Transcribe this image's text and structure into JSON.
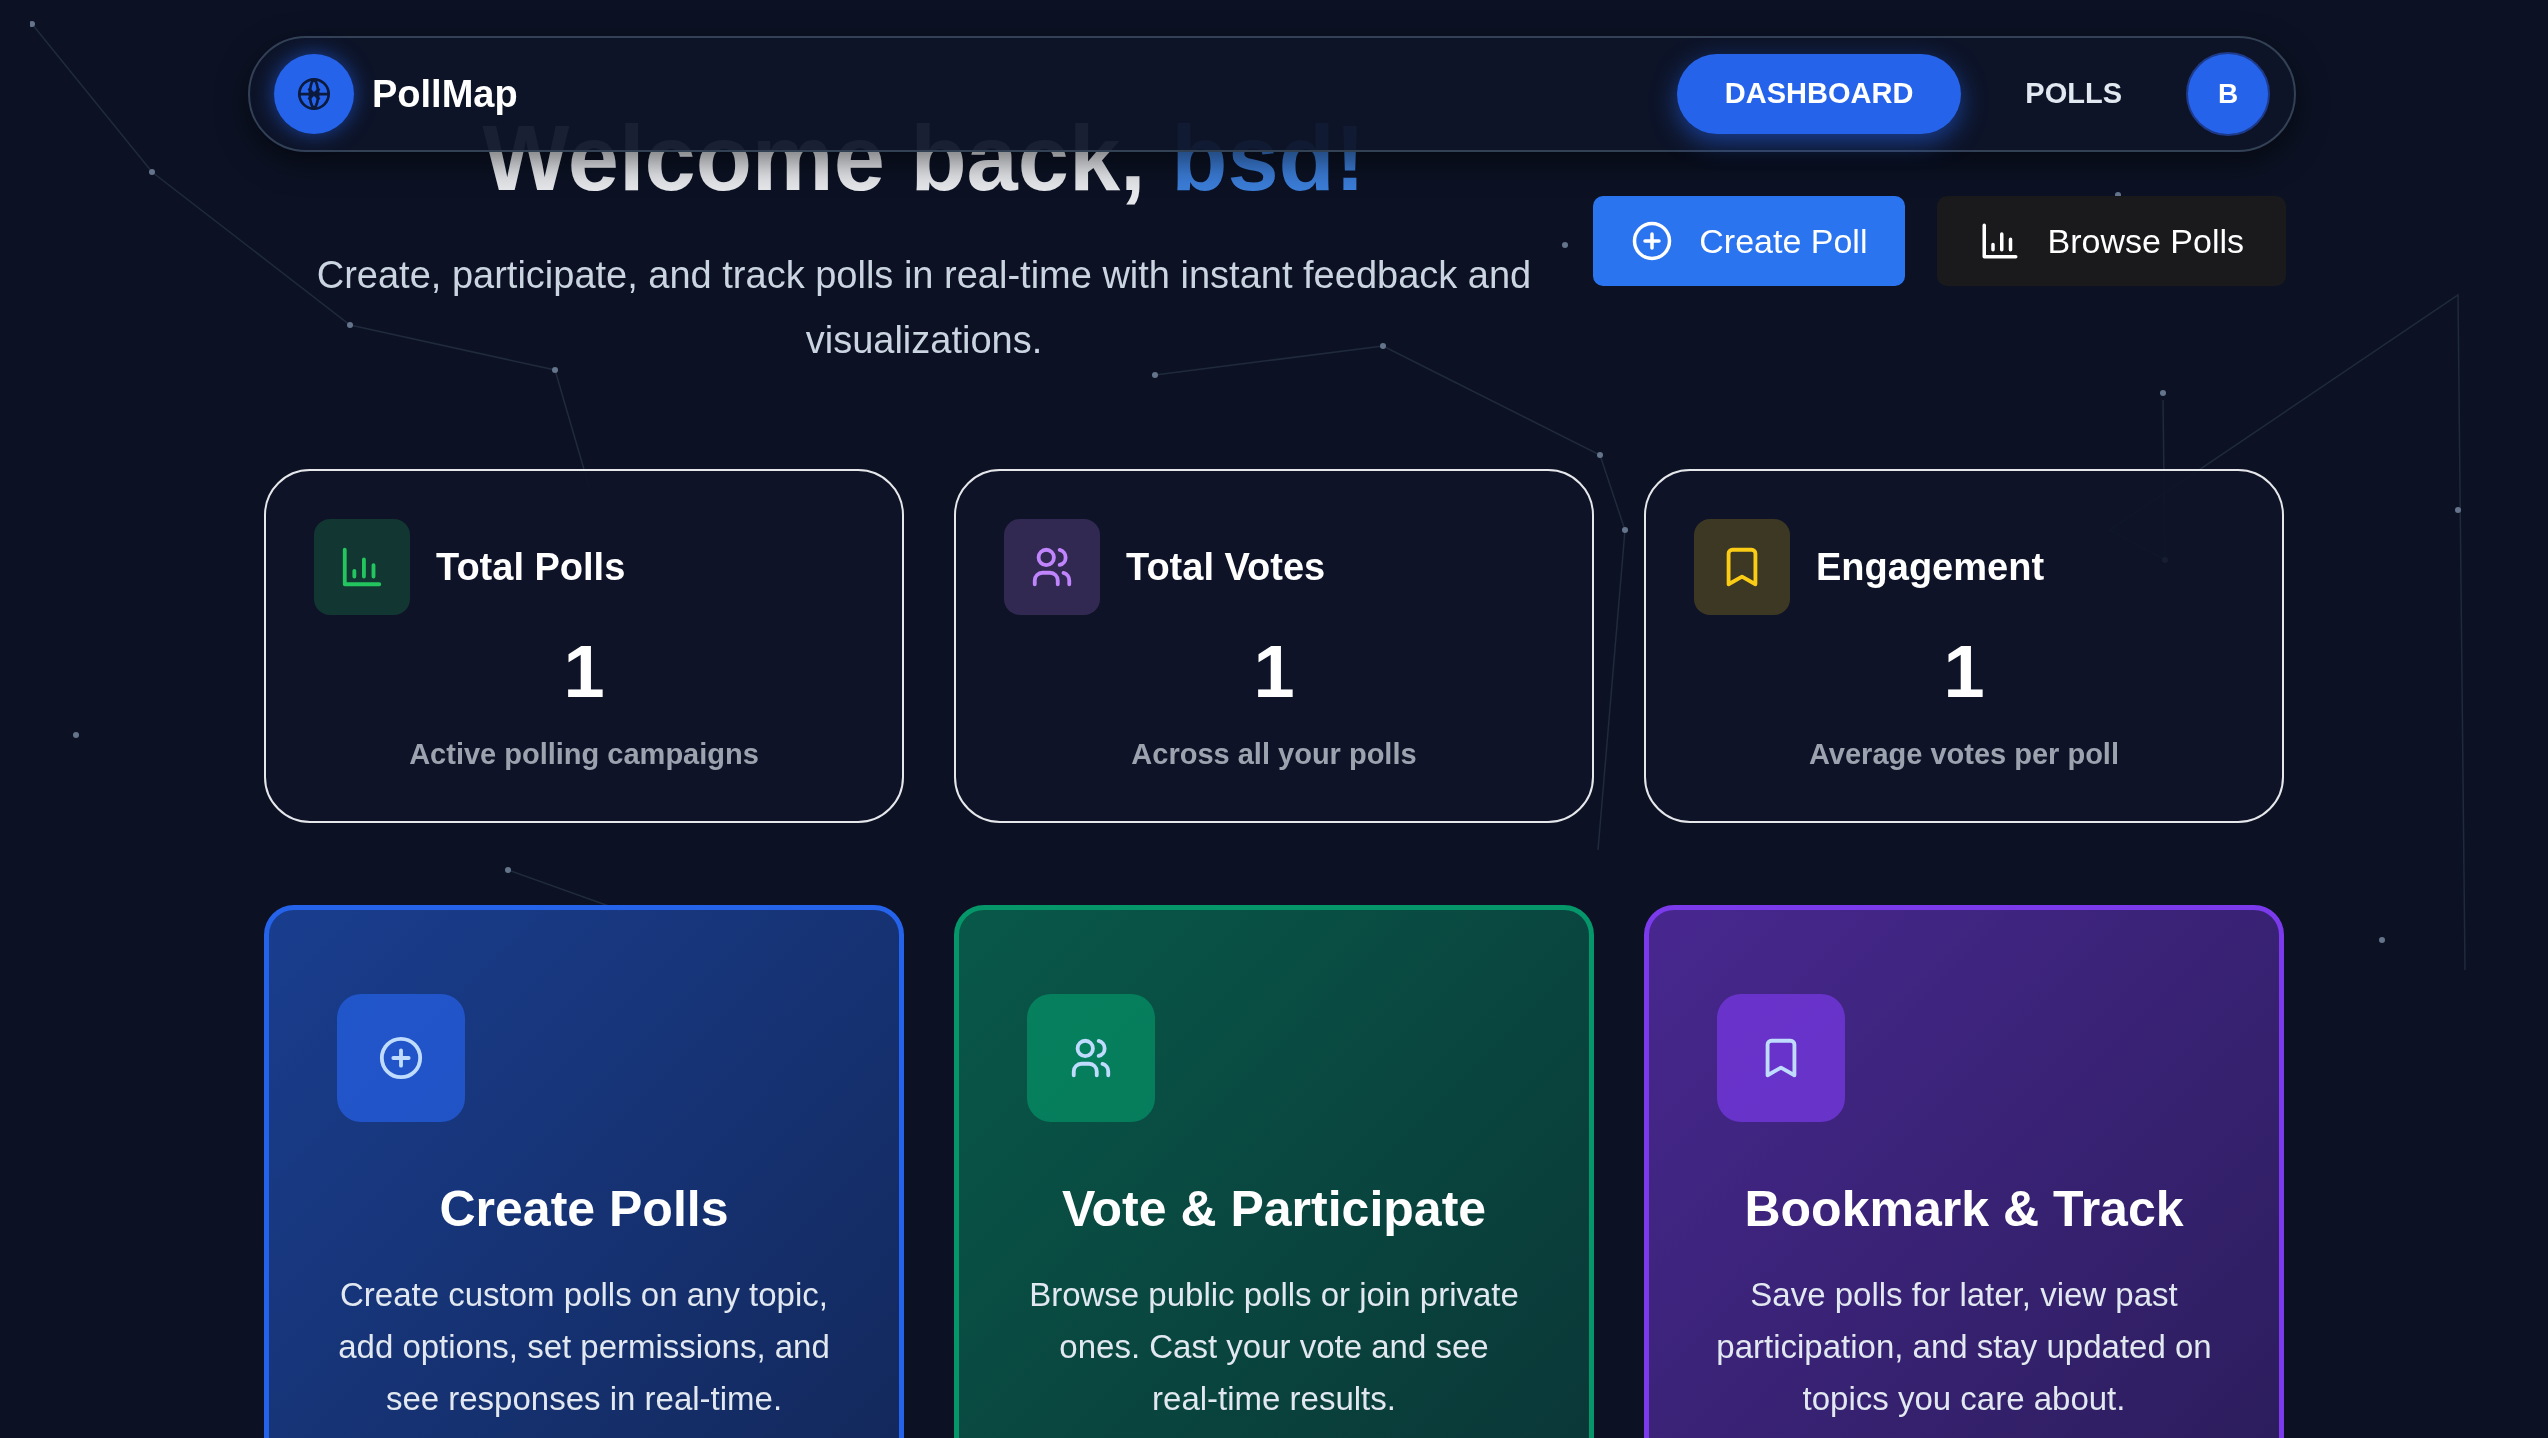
{
  "nav": {
    "brand": "PollMap",
    "links": [
      {
        "label": "DASHBOARD",
        "selected": true
      },
      {
        "label": "POLLS",
        "selected": false
      }
    ],
    "avatar": "B"
  },
  "hero": {
    "greeting": "Welcome back,",
    "name": "bsd!",
    "subtitle": "Create, participate, and track polls in real-time with instant feedback and visualizations.",
    "actions": [
      {
        "label": "Create Poll",
        "kind": "primary"
      },
      {
        "label": "Browse Polls",
        "kind": "secondary"
      }
    ]
  },
  "stats": [
    {
      "title": "Total Polls",
      "value": "1",
      "caption": "Active polling campaigns",
      "color": "#22c55e"
    },
    {
      "title": "Total Votes",
      "value": "1",
      "caption": "Across all your polls",
      "color": "#c084fc"
    },
    {
      "title": "Engagement",
      "value": "1",
      "caption": "Average votes per poll",
      "color": "#facc15"
    }
  ],
  "features": [
    {
      "title": "Create Polls",
      "description": "Create custom polls on any topic, add options, set permissions, and see responses in real-time.",
      "color": "#2563eb"
    },
    {
      "title": "Vote & Participate",
      "description": "Browse public polls or join private ones. Cast your vote and see real-time results.",
      "color": "#059669"
    },
    {
      "title": "Bookmark & Track",
      "description": "Save polls for later, view past participation, and stay updated on topics you care about.",
      "color": "#7c3aed"
    }
  ]
}
